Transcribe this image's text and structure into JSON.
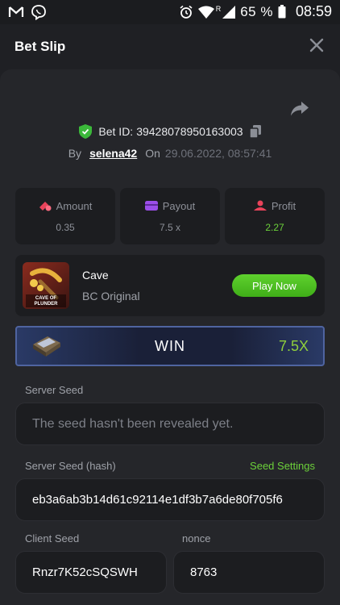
{
  "status_bar": {
    "battery_pct": "65 %",
    "time": "08:59",
    "roaming": "R"
  },
  "header": {
    "title": "Bet Slip"
  },
  "bet": {
    "bet_id_label": "Bet ID:",
    "bet_id": "39428078950163003",
    "by_label": "By",
    "user": "selena42",
    "on_label": "On",
    "datetime": "29.06.2022, 08:57:41"
  },
  "stats": [
    {
      "label": "Amount",
      "value": "0.35",
      "icon": "coins-icon"
    },
    {
      "label": "Payout",
      "value": "7.5 x",
      "icon": "wallet-icon"
    },
    {
      "label": "Profit",
      "value": "2.27",
      "icon": "profit-icon"
    }
  ],
  "game": {
    "name": "Cave",
    "subtitle": "BC Original",
    "thumb_text": "CAVE OF PLUNDER",
    "play_label": "Play Now"
  },
  "result": {
    "label": "WIN",
    "multiplier": "7.5X"
  },
  "seeds": {
    "server_seed_label": "Server Seed",
    "server_seed_placeholder": "The seed hasn't been revealed yet.",
    "server_hash_label": "Server Seed (hash)",
    "seed_settings_label": "Seed Settings",
    "server_hash": "eb3a6ab3b14d61c92114e1df3b7a6de80f705f6",
    "client_seed_label": "Client Seed",
    "client_seed": "Rnzr7K52cSQSWH",
    "nonce_label": "nonce",
    "nonce": "8763"
  },
  "colors": {
    "accent_green": "#6cd13a",
    "sheet_bg": "#25262a",
    "card_bg": "#1c1d20",
    "win_border": "#4f64a0"
  }
}
